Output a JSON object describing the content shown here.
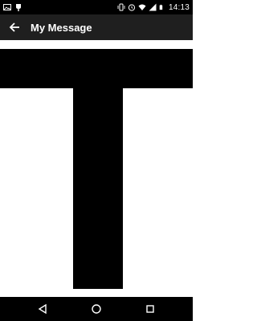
{
  "status_bar": {
    "time": "14:13",
    "left_icons": [
      "image-icon",
      "notification-icon"
    ],
    "right_icons": [
      "vibrate-icon",
      "alarm-icon",
      "wifi-icon",
      "signal-icon",
      "battery-icon"
    ]
  },
  "app_bar": {
    "title": "My Message",
    "back_icon": "arrow-back-icon"
  },
  "content": {
    "letter": "T",
    "letter_color": "#000000",
    "background_color": "#ffffff"
  },
  "nav_bar": {
    "buttons": [
      "back-triangle-icon",
      "home-circle-icon",
      "recents-square-icon"
    ]
  },
  "colors": {
    "status_bar": "#000000",
    "app_bar": "#1f1f1f",
    "nav_bar": "#000000"
  }
}
